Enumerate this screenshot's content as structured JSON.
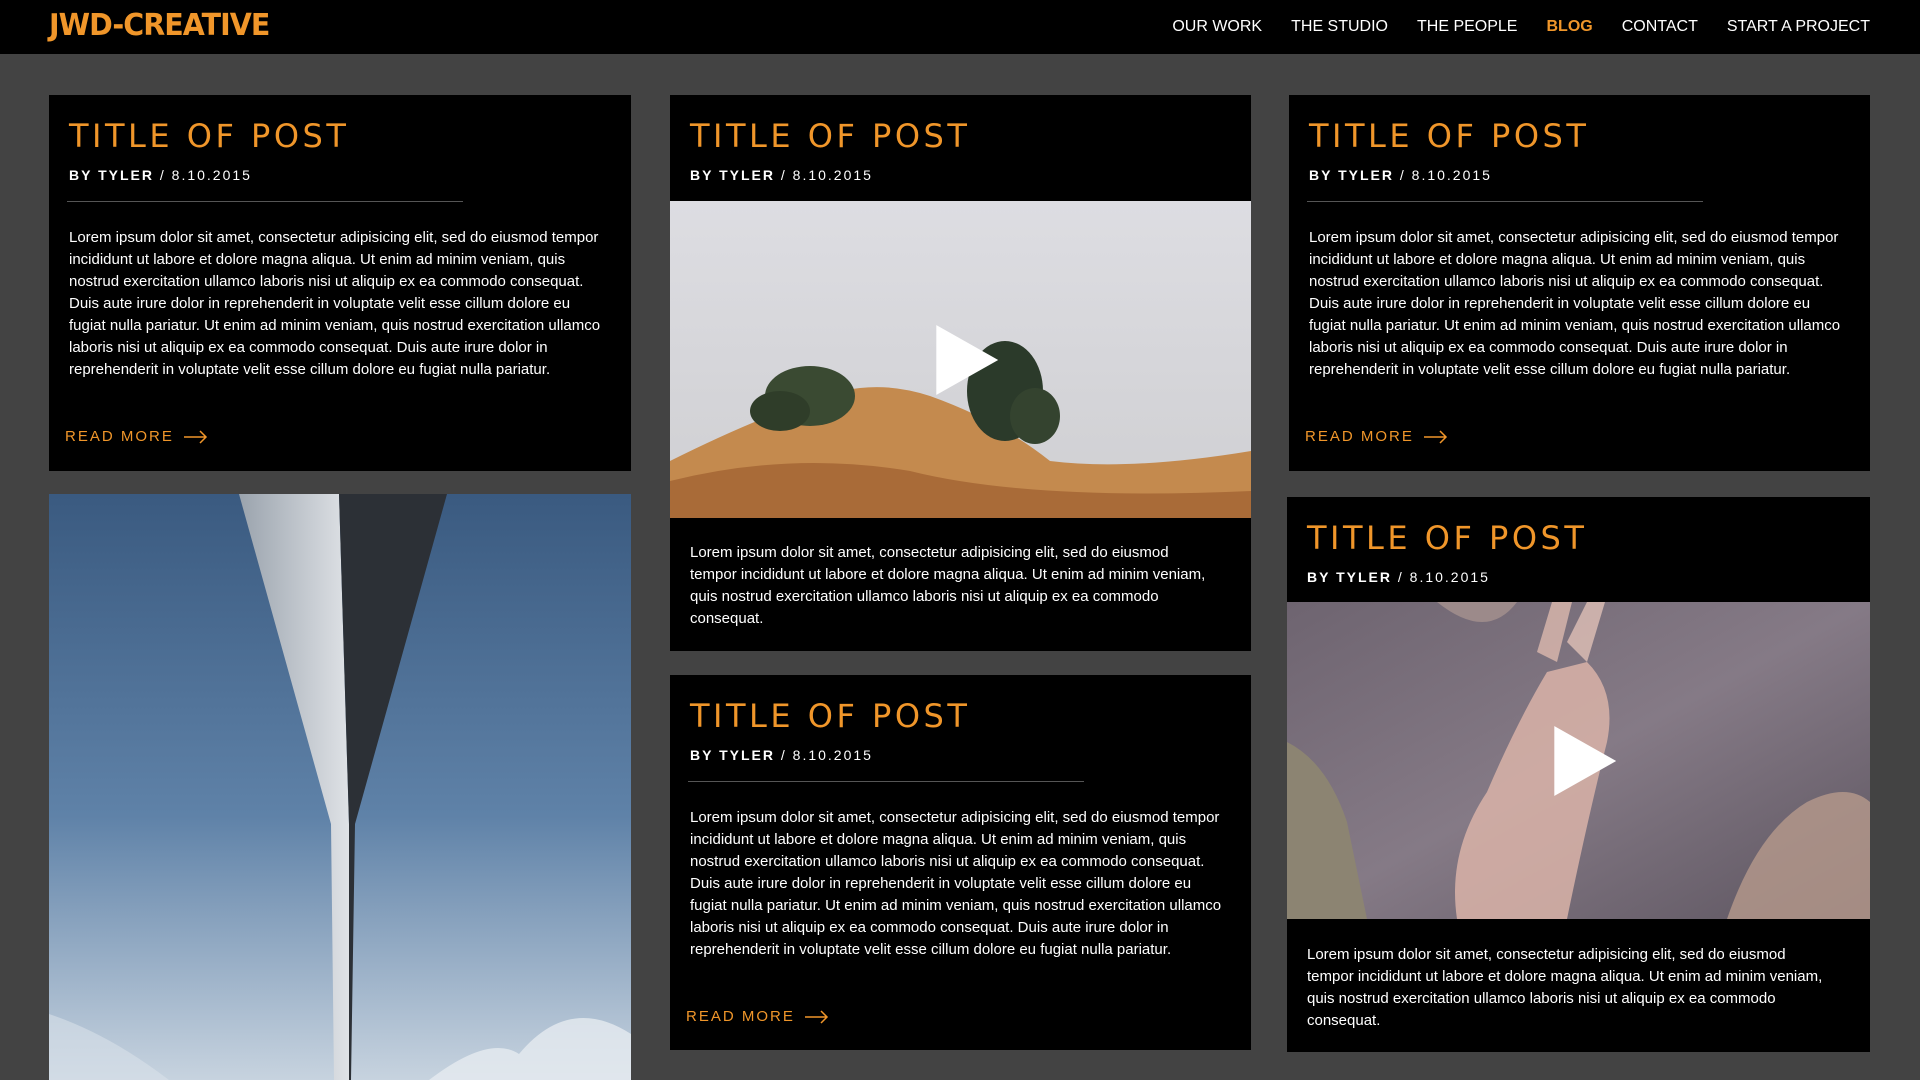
{
  "brand": {
    "logo": "JWD-CREATIVE"
  },
  "nav": {
    "items": [
      {
        "label": "OUR WORK"
      },
      {
        "label": "THE STUDIO"
      },
      {
        "label": "THE PEOPLE"
      },
      {
        "label": "BLOG",
        "active": true
      },
      {
        "label": "CONTACT"
      },
      {
        "label": "START A PROJECT"
      }
    ]
  },
  "posts": {
    "p1": {
      "title": "TITLE OF POST",
      "by": "BY TYLER",
      "sep": " / ",
      "date": "8.10.2015",
      "body": "Lorem ipsum dolor sit amet, consectetur adipisicing elit, sed do eiusmod tempor incididunt ut labore et dolore magna aliqua. Ut enim ad minim veniam, quis nostrud exercitation ullamco laboris nisi ut aliquip ex ea commodo consequat. Duis aute irure dolor in reprehenderit in voluptate velit esse cillum dolore eu fugiat nulla pariatur. Ut enim ad minim veniam, quis nostrud exercitation ullamco laboris nisi ut aliquip ex ea commodo consequat. Duis aute irure dolor in reprehenderit in voluptate velit esse cillum dolore eu fugiat nulla pariatur.",
      "read_more": "READ MORE"
    },
    "p2": {
      "title": "TITLE OF POST",
      "by": "BY TYLER",
      "sep": " / ",
      "date": "8.10.2015",
      "body": "Lorem ipsum dolor sit amet, consectetur adipisicing elit, sed do eiusmod tempor incididunt ut labore et dolore magna aliqua. Ut enim ad minim veniam, quis nostrud exercitation ullamco laboris nisi ut aliquip ex ea commodo consequat."
    },
    "p3": {
      "title": "TITLE OF POST",
      "by": "BY TYLER",
      "sep": " / ",
      "date": "8.10.2015",
      "body": "Lorem ipsum dolor sit amet, consectetur adipisicing elit, sed do eiusmod tempor incididunt ut labore et dolore magna aliqua. Ut enim ad minim veniam, quis nostrud exercitation ullamco laboris nisi ut aliquip ex ea commodo consequat. Duis aute irure dolor in reprehenderit in voluptate velit esse cillum dolore eu fugiat nulla pariatur. Ut enim ad minim veniam, quis nostrud exercitation ullamco laboris nisi ut aliquip ex ea commodo consequat. Duis aute irure dolor in reprehenderit in voluptate velit esse cillum dolore eu fugiat nulla pariatur.",
      "read_more": "READ MORE"
    },
    "p4": {
      "title": "TITLE OF POST",
      "by": "BY TYLER",
      "sep": " / ",
      "date": "8.10.2015",
      "body": "Lorem ipsum dolor sit amet, consectetur adipisicing elit, sed do eiusmod tempor incididunt ut labore et dolore magna aliqua. Ut enim ad minim veniam, quis nostrud exercitation ullamco laboris nisi ut aliquip ex ea commodo consequat. Duis aute irure dolor in reprehenderit in voluptate velit esse cillum dolore eu fugiat nulla pariatur. Ut enim ad minim veniam, quis nostrud exercitation ullamco laboris nisi ut aliquip ex ea commodo consequat. Duis aute irure dolor in reprehenderit in voluptate velit esse cillum dolore eu fugiat nulla pariatur.",
      "read_more": "READ MORE"
    },
    "p5": {
      "title": "TITLE OF POST",
      "by": "BY TYLER",
      "sep": " / ",
      "date": "8.10.2015",
      "body": "Lorem ipsum dolor sit amet, consectetur adipisicing elit, sed do eiusmod tempor incididunt ut labore et dolore magna aliqua. Ut enim ad minim veniam, quis nostrud exercitation ullamco laboris nisi ut aliquip ex ea commodo consequat."
    }
  },
  "icons": {
    "play": "play-icon",
    "arrow": "arrow-right-icon"
  },
  "colors": {
    "accent": "#f0962a",
    "background": "#434343",
    "card": "#000000"
  }
}
